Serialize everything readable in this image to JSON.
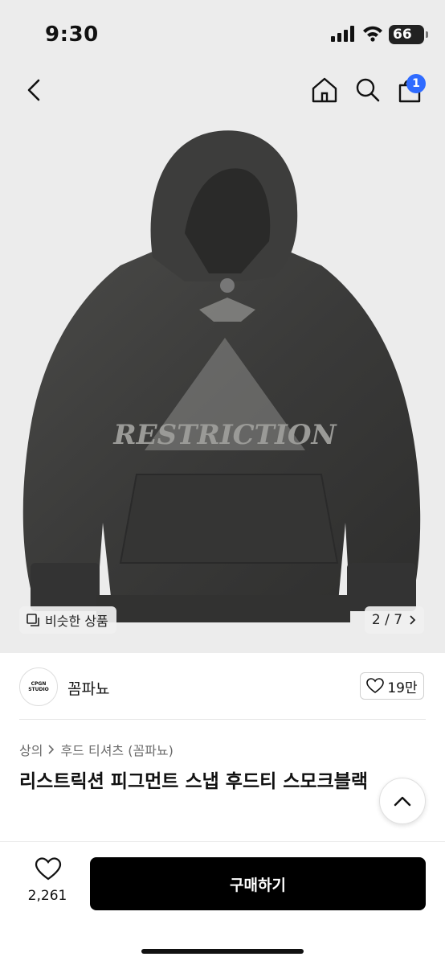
{
  "status_bar": {
    "time": "9:30",
    "battery": "66"
  },
  "nav": {
    "cart_count": "1"
  },
  "image_overlay": {
    "similar_label": "비슷한 상품",
    "counter": "2 / 7",
    "graphic_text": "RESTRICTION"
  },
  "store": {
    "logo_text": "CPGN STUDIO",
    "name": "꼼파뇨",
    "likes": "19만"
  },
  "breadcrumb": [
    "상의",
    "후드 티셔츠 (꼼파뇨)"
  ],
  "product": {
    "title": "리스트릭션 피그먼트 스냅 후드티 스모크블랙"
  },
  "bottom": {
    "favorites": "2,261",
    "buy_label": "구매하기"
  }
}
